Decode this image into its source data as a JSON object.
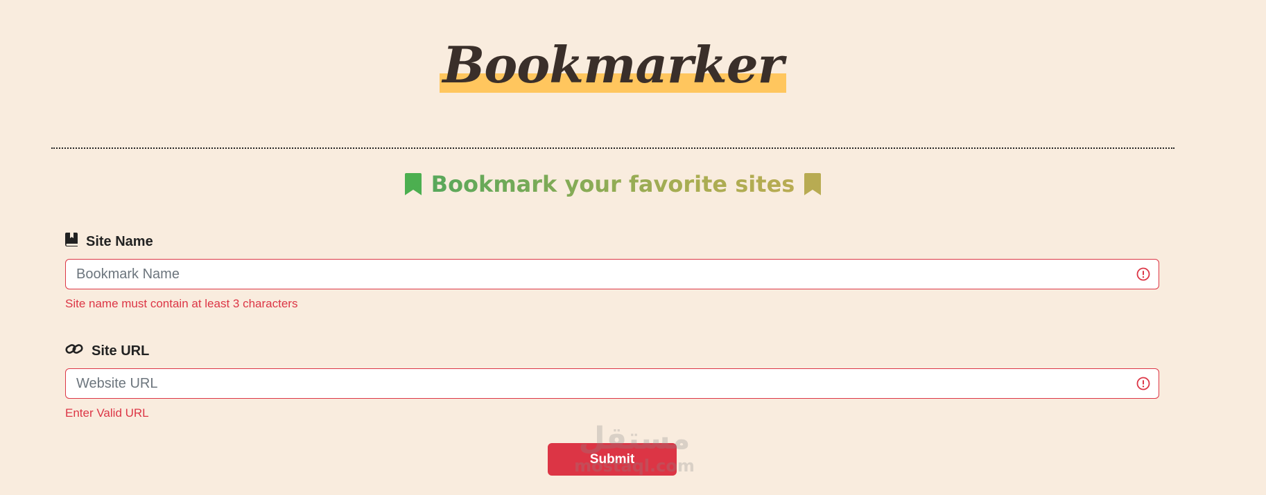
{
  "header": {
    "title": "Bookmarker",
    "subtitle": "Bookmark your favorite sites"
  },
  "form": {
    "site_name": {
      "label": "Site Name",
      "placeholder": "Bookmark Name",
      "value": "",
      "error": "Site name must contain at least 3 characters",
      "icon": "book-icon"
    },
    "site_url": {
      "label": "Site URL",
      "placeholder": "Website URL",
      "value": "",
      "error": "Enter Valid URL",
      "icon": "link-icon"
    },
    "submit_label": "Submit"
  },
  "watermark": {
    "arabic": "مستقل",
    "latin": "mostaql.com"
  },
  "colors": {
    "background": "#f9ecde",
    "title_highlight": "#ffc65e",
    "error": "#dc3545",
    "bookmark_green": "#4caf50",
    "bookmark_olive": "#b8ab52"
  }
}
